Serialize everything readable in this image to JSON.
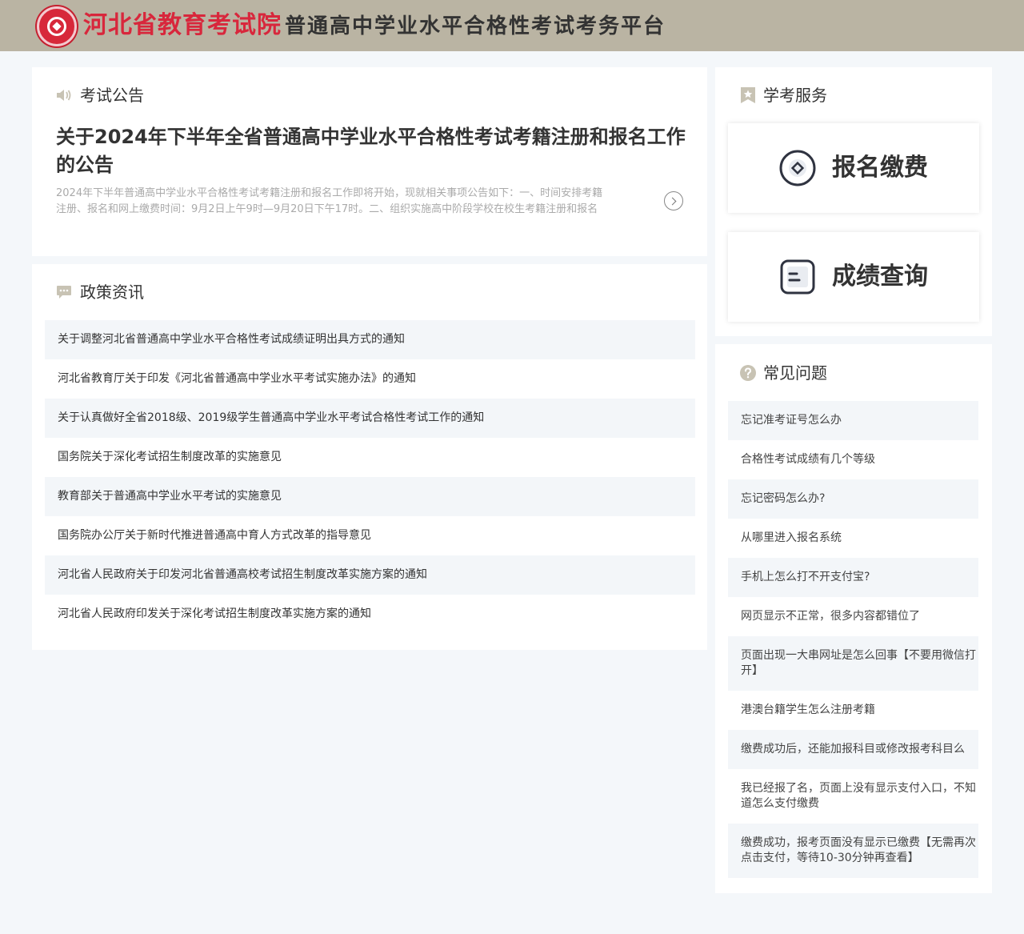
{
  "header": {
    "org_name": "河北省教育考试院",
    "platform_name": "普通高中学业水平合格性考试考务平台"
  },
  "notice": {
    "section_title": "考试公告",
    "headline": "关于2024年下半年全省普通高中学业水平合格性考试考籍注册和报名工作的公告",
    "summary": "2024年下半年普通高中学业水平合格性考试考籍注册和报名工作即将开始，现就相关事项公告如下：一、时间安排考籍注册、报名和网上缴费时间：9月2日上午9时—9月20日下午17时。二、组织实施高中阶段学校在校生考籍注册和报名工"
  },
  "policy": {
    "section_title": "政策资讯",
    "items": [
      "关于调整河北省普通高中学业水平合格性考试成绩证明出具方式的通知",
      "河北省教育厅关于印发《河北省普通高中学业水平考试实施办法》的通知",
      "关于认真做好全省2018级、2019级学生普通高中学业水平考试合格性考试工作的通知",
      "国务院关于深化考试招生制度改革的实施意见",
      "教育部关于普通高中学业水平考试的实施意见",
      "国务院办公厅关于新时代推进普通高中育人方式改革的指导意见",
      "河北省人民政府关于印发河北省普通高校考试招生制度改革实施方案的通知",
      "河北省人民政府印发关于深化考试招生制度改革实施方案的通知"
    ]
  },
  "service": {
    "section_title": "学考服务",
    "register_pay_label": "报名缴费",
    "score_query_label": "成绩查询"
  },
  "faq": {
    "section_title": "常见问题",
    "items": [
      "忘记准考证号怎么办",
      "合格性考试成绩有几个等级",
      "忘记密码怎么办?",
      "从哪里进入报名系统",
      "手机上怎么打不开支付宝?",
      "网页显示不正常，很多内容都错位了",
      "页面出现一大串网址是怎么回事【不要用微信打开】",
      "港澳台籍学生怎么注册考籍",
      "缴费成功后，还能加报科目或修改报考科目么",
      "我已经报了名，页面上没有显示支付入口，不知道怎么支付缴费",
      "缴费成功，报考页面没有显示已缴费【无需再次点击支付，等待10-30分钟再查看】"
    ]
  },
  "colors": {
    "header_bg": "#bab4a3",
    "brand_red": "#d8273c",
    "icon_gray": "#c8c3b4",
    "page_bg": "#f4f7fa"
  },
  "icons": {
    "notice": "speaker-icon",
    "policy": "chat-bubble-icon",
    "service": "bookmark-star-icon",
    "faq": "question-circle-icon",
    "register_pay": "coin-icon",
    "score_query": "score-sheet-icon",
    "more": "chevron-right-icon"
  }
}
